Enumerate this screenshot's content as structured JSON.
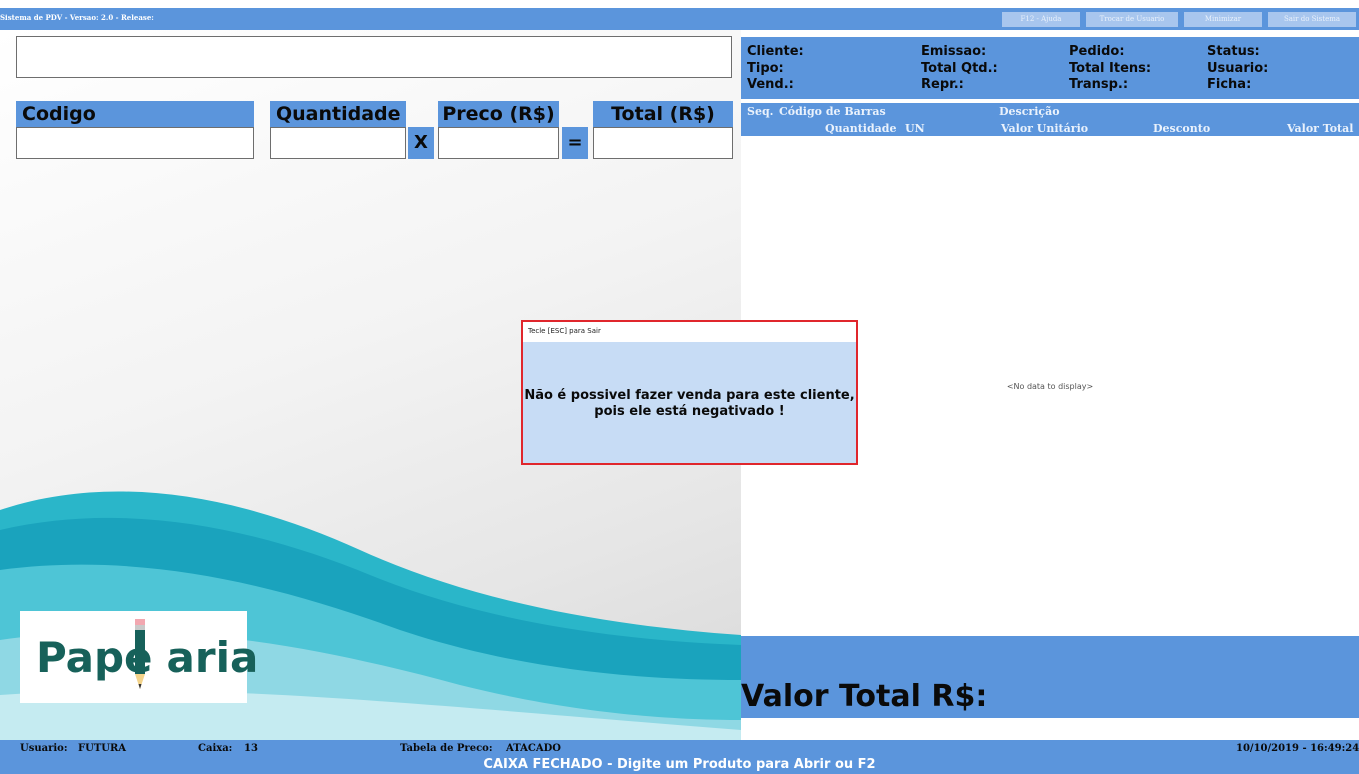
{
  "titlebar": {
    "title": "Sistema de PDV - Versao: 2.0 - Release:",
    "buttons": [
      "F12 - Ajuda",
      "Trocar de Usuario",
      "Minimizar",
      "Sair do Sistema"
    ]
  },
  "entry": {
    "code_label": "Codigo",
    "qty_label": "Quantidade",
    "price_label": "Preco (R$)",
    "total_label": "Total (R$)",
    "times_op": "X",
    "equals_op": "="
  },
  "logo": {
    "text_left": "Pape",
    "text_right": "aria"
  },
  "sale_info": {
    "col1": [
      "Cliente:",
      "Tipo:",
      "Vend.:"
    ],
    "col2": [
      "Emissao:",
      "Total Qtd.:",
      "Repr.:"
    ],
    "col3": [
      "Pedido:",
      "Total Itens:",
      "Transp.:"
    ],
    "col4": [
      "Status:",
      "Usuario:",
      "Ficha:"
    ]
  },
  "grid": {
    "row1": [
      "Seq.",
      "Código de Barras",
      "Descrição"
    ],
    "row2": [
      "Quantidade",
      "UN",
      "Valor Unitário",
      "Desconto",
      "Valor Total"
    ],
    "empty_text": "<No data to display>"
  },
  "total": {
    "label": "Valor Total R$:"
  },
  "statusbar": {
    "user_label": "Usuario:",
    "user_value": "FUTURA",
    "caixa_label": "Caixa:",
    "caixa_value": "13",
    "tabela_label": "Tabela de Preco:",
    "tabela_value": "ATACADO",
    "datetime": "10/10/2019 - 16:49:24",
    "message": "CAIXA FECHADO - Digite um Produto para Abrir ou F2"
  },
  "dialog": {
    "title": "Tecle [ESC] para Sair",
    "line1": "Não é possivel fazer venda para este cliente,",
    "line2": "pois ele está negativado !"
  },
  "colors": {
    "accent": "#5b95dc",
    "dialog_border": "#e0262c",
    "dialog_bg": "#c7dcf5",
    "logo": "#17615a"
  }
}
